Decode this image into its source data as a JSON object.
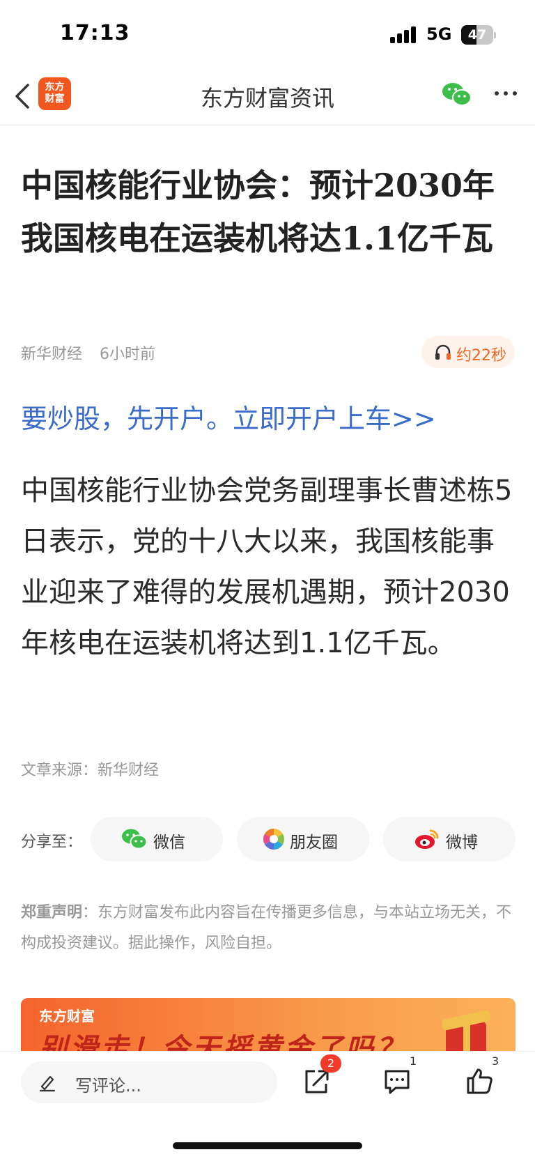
{
  "status_bar": {
    "time": "17:13",
    "network": "5G",
    "battery": "47",
    "battery_level": 0.47
  },
  "nav": {
    "logo_line1": "东方",
    "logo_line2": "财富",
    "title": "东方财富资讯",
    "icons": [
      "back-icon",
      "wechat-icon",
      "more-icon"
    ]
  },
  "article": {
    "headline": "中国核能行业协会：预计2030年我国核电在运装机将达1.1亿千瓦",
    "source_name": "新华财经",
    "time_ago": "6小时前",
    "audio_label": "约22秒",
    "promo_link": "要炒股，先开户。立即开户上车>>",
    "body": "中国核能行业协会党务副理事长曹述栋5日表示，党的十八大以来，我国核能事业迎来了难得的发展机遇期，预计2030年核电在运装机将达到1.1亿千瓦。",
    "article_source": "文章来源：新华财经"
  },
  "share": {
    "label": "分享至：",
    "wechat": "微信",
    "moments": "朋友圈",
    "weibo": "微博"
  },
  "disclaimer": {
    "title": "郑重声明",
    "text": "：东方财富发布此内容旨在传播更多信息，与本站立场无关，不构成投资建议。据此操作，风险自担。"
  },
  "banner": {
    "brand": "东方财富",
    "slogan": "别滑走！今天摇黄金了吗？"
  },
  "bottom_bar": {
    "comment_placeholder": "写评论...",
    "share_badge": "2",
    "comment_count": "1",
    "like_count": "3"
  },
  "colors": {
    "brand_orange": "#f2571f",
    "link_blue": "#3b6cc7",
    "audio_orange": "#f0661e",
    "badge_red": "#f03a2a"
  }
}
